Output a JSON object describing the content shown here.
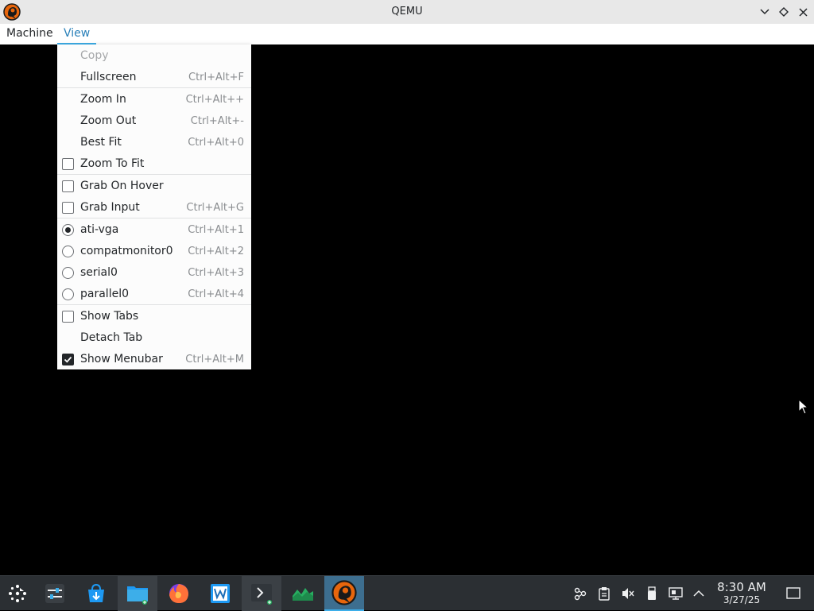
{
  "window": {
    "title": "QEMU"
  },
  "menubar": {
    "items": [
      {
        "label": "Machine"
      },
      {
        "label": "View"
      }
    ]
  },
  "view_menu": {
    "items": [
      {
        "label": "Copy",
        "shortcut": "",
        "indicator": "none",
        "checked": false,
        "disabled": true
      },
      {
        "label": "Fullscreen",
        "shortcut": "Ctrl+Alt+F",
        "indicator": "none",
        "checked": false,
        "disabled": false
      },
      {
        "label": "Zoom In",
        "shortcut": "Ctrl+Alt++",
        "indicator": "none",
        "checked": false,
        "disabled": false
      },
      {
        "label": "Zoom Out",
        "shortcut": "Ctrl+Alt+-",
        "indicator": "none",
        "checked": false,
        "disabled": false
      },
      {
        "label": "Best Fit",
        "shortcut": "Ctrl+Alt+0",
        "indicator": "none",
        "checked": false,
        "disabled": false
      },
      {
        "label": "Zoom To Fit",
        "shortcut": "",
        "indicator": "checkbox",
        "checked": false,
        "disabled": false
      },
      {
        "label": "Grab On Hover",
        "shortcut": "",
        "indicator": "checkbox",
        "checked": false,
        "disabled": false
      },
      {
        "label": "Grab Input",
        "shortcut": "Ctrl+Alt+G",
        "indicator": "checkbox",
        "checked": false,
        "disabled": false
      },
      {
        "label": "ati-vga",
        "shortcut": "Ctrl+Alt+1",
        "indicator": "radio",
        "checked": true,
        "disabled": false
      },
      {
        "label": "compatmonitor0",
        "shortcut": "Ctrl+Alt+2",
        "indicator": "radio",
        "checked": false,
        "disabled": false
      },
      {
        "label": "serial0",
        "shortcut": "Ctrl+Alt+3",
        "indicator": "radio",
        "checked": false,
        "disabled": false
      },
      {
        "label": "parallel0",
        "shortcut": "Ctrl+Alt+4",
        "indicator": "radio",
        "checked": false,
        "disabled": false
      },
      {
        "label": "Show Tabs",
        "shortcut": "",
        "indicator": "checkbox",
        "checked": false,
        "disabled": false
      },
      {
        "label": "Detach Tab",
        "shortcut": "",
        "indicator": "none",
        "checked": false,
        "disabled": false
      },
      {
        "label": "Show Menubar",
        "shortcut": "Ctrl+Alt+M",
        "indicator": "checkbox",
        "checked": true,
        "disabled": false
      }
    ]
  },
  "taskbar": {
    "launcher_icon": "application-launcher-icon",
    "apps": [
      {
        "icon": "system-settings-icon"
      },
      {
        "icon": "discover-store-icon"
      },
      {
        "icon": "file-manager-icon"
      },
      {
        "icon": "firefox-icon"
      },
      {
        "icon": "writer-icon"
      },
      {
        "icon": "terminal-icon"
      },
      {
        "icon": "system-monitor-icon"
      },
      {
        "icon": "qemu-icon"
      }
    ],
    "tray": [
      {
        "icon": "network-share-icon"
      },
      {
        "icon": "clipboard-icon"
      },
      {
        "icon": "volume-muted-icon"
      },
      {
        "icon": "usb-device-icon"
      },
      {
        "icon": "network-wired-icon"
      },
      {
        "icon": "tray-expand-arrow-icon"
      }
    ],
    "clock": {
      "time": "8:30 AM",
      "date": "3/27/25"
    },
    "show_desktop_icon": "show-desktop-icon"
  },
  "colors": {
    "accent": "#3daee9",
    "titlebar_bg": "#e8e8e8",
    "taskbar_bg": "#2b2f33",
    "vm_display_bg": "#000000"
  }
}
